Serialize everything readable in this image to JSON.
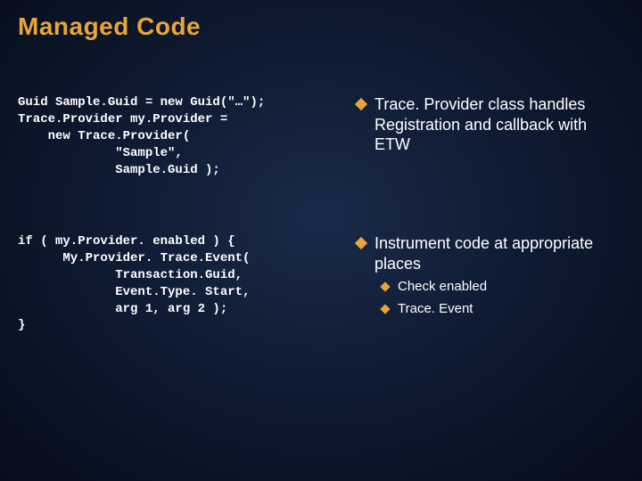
{
  "title": "Managed Code",
  "left": {
    "code1": "Guid Sample.Guid = new Guid(\"…\");\nTrace.Provider my.Provider =\n    new Trace.Provider(\n             \"Sample\",\n             Sample.Guid );",
    "code2": "if ( my.Provider. enabled ) {\n      My.Provider. Trace.Event(\n             Transaction.Guid,\n             Event.Type. Start,\n             arg 1, arg 2 );\n}"
  },
  "right": {
    "bullet1": "Trace. Provider class handles Registration and callback with ETW",
    "bullet2": "Instrument code at appropriate places",
    "sub": [
      "Check enabled",
      "Trace. Event"
    ]
  }
}
